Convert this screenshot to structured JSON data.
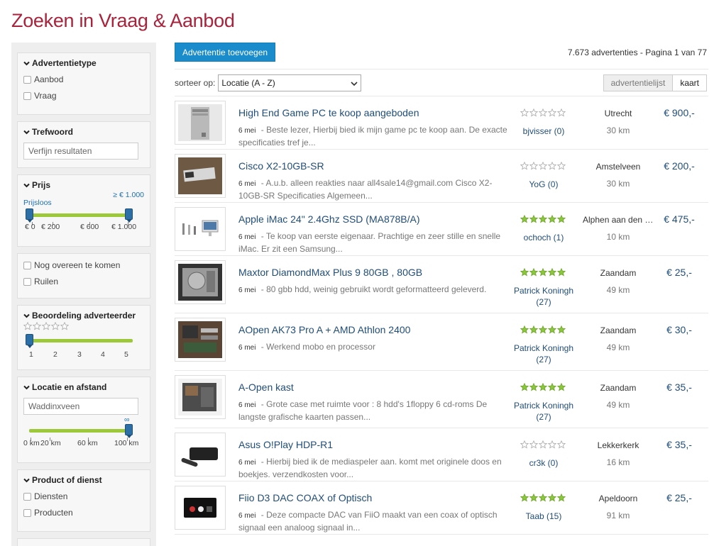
{
  "page": {
    "title": "Zoeken in Vraag & Aanbod"
  },
  "sidebar": {
    "ad_type": {
      "title": "Advertentietype",
      "options": [
        "Aanbod",
        "Vraag"
      ]
    },
    "keyword": {
      "title": "Trefwoord",
      "placeholder": "Verfijn resultaten"
    },
    "price": {
      "title": "Prijs",
      "max_label": "≥ € 1.000",
      "min_label": "Prijsloos",
      "ticks": [
        "€ 0",
        "€ 200",
        "€ 600",
        "€ 1.000"
      ]
    },
    "extras": {
      "options": [
        "Nog overeen te komen",
        "Ruilen"
      ]
    },
    "rating": {
      "title": "Beoordeling adverteerder",
      "ticks": [
        "1",
        "2",
        "3",
        "4",
        "5"
      ]
    },
    "location": {
      "title": "Locatie en afstand",
      "placeholder": "Waddinxveen",
      "max_label": "∞",
      "ticks": [
        "0 km",
        "20 km",
        "60 km",
        "100 km"
      ]
    },
    "product_type": {
      "title": "Product of dienst",
      "options": [
        "Diensten",
        "Producten"
      ]
    }
  },
  "toolbar": {
    "add_button": "Advertentie toevoegen",
    "result_count": "7.673 advertenties - Pagina 1 van 77",
    "sort_label": "sorteer op:",
    "sort_value": "Locatie (A - Z)",
    "view_list": "advertentielijst",
    "view_map": "kaart"
  },
  "colors": {
    "title": "#a8233b",
    "link": "#1f4d7a",
    "button": "#1b8ccb",
    "star_on": "#8cc63f",
    "slider": "#9dc83a"
  },
  "listings": [
    {
      "title": "High End Game PC te koop aangeboden",
      "date": "6 mei",
      "desc": " - Beste lezer, Hierbij bied ik mijn game pc te koop aan. De exacte specificaties tref je...",
      "rating": 0,
      "seller": "bjvisser (0)",
      "city": "Utrecht",
      "distance": "30 km",
      "price": "€ 900,-",
      "image": "pc-tower"
    },
    {
      "title": "Cisco X2-10GB-SR",
      "date": "6 mei",
      "desc": " - A.u.b. alleen reakties naar all4sale14@gmail.com Cisco X2-10GB-SR Specificaties Algemeen...",
      "rating": 0,
      "seller": "YoG (0)",
      "city": "Amstelveen",
      "distance": "30 km",
      "price": "€ 200,-",
      "image": "module"
    },
    {
      "title": "Apple iMac 24\" 2.4Ghz SSD (MA878B/A)",
      "date": "6 mei",
      "desc": " - Te koop van eerste eigenaar. Prachtige en zeer stille en snelle iMac. Er zit een Samsung...",
      "rating": 5,
      "seller": "ochoch (1)",
      "city": "Alphen aan den Rijn",
      "distance": "10 km",
      "price": "€ 475,-",
      "image": "imac"
    },
    {
      "title": "Maxtor DiamondMax Plus 9 80GB , 80GB",
      "date": "6 mei",
      "desc": " - 80 gbb hdd, weinig gebruikt wordt geformatteerd geleverd.",
      "rating": 5,
      "seller": "Patrick Koningh (27)",
      "city": "Zaandam",
      "distance": "49 km",
      "price": "€ 25,-",
      "image": "hdd"
    },
    {
      "title": "AOpen AK73 Pro A + AMD Athlon 2400",
      "date": "6 mei",
      "desc": " - Werkend mobo en processor",
      "rating": 5,
      "seller": "Patrick Koningh (27)",
      "city": "Zaandam",
      "distance": "49 km",
      "price": "€ 30,-",
      "image": "mobo"
    },
    {
      "title": "A-Open kast",
      "date": "6 mei",
      "desc": " - Grote case met ruimte voor : 8 hdd's 1floppy 6 cd-roms De langste grafische kaarten passen...",
      "rating": 5,
      "seller": "Patrick Koningh (27)",
      "city": "Zaandam",
      "distance": "49 km",
      "price": "€ 35,-",
      "image": "case"
    },
    {
      "title": "Asus O!Play HDP-R1",
      "date": "6 mei",
      "desc": " - Hierbij bied ik de mediaspeler aan. komt met originele doos en boekjes. verzendkosten voor...",
      "rating": 0,
      "seller": "cr3k (0)",
      "city": "Lekkerkerk",
      "distance": "16 km",
      "price": "€ 35,-",
      "image": "player"
    },
    {
      "title": "Fiio D3 DAC COAX of Optisch",
      "date": "6 mei",
      "desc": " - Deze compacte DAC van FiiO maakt van een coax of optisch signaal een analoog signaal in...",
      "rating": 5,
      "seller": "Taab (15)",
      "city": "Apeldoorn",
      "distance": "91 km",
      "price": "€ 25,-",
      "image": "dac"
    }
  ]
}
